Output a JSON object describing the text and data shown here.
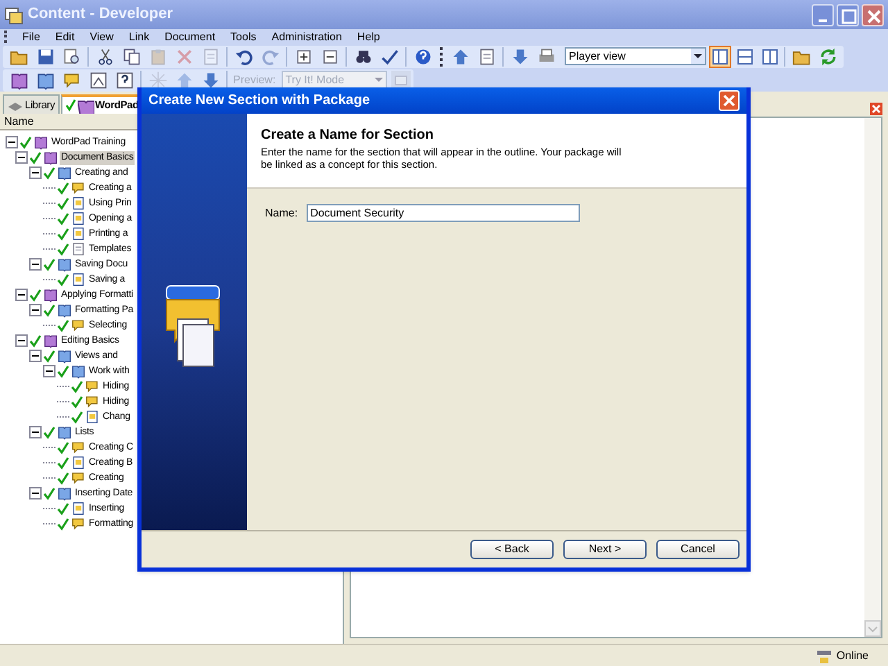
{
  "window": {
    "title": "Content - Developer"
  },
  "menu": [
    "File",
    "Edit",
    "View",
    "Link",
    "Document",
    "Tools",
    "Administration",
    "Help"
  ],
  "toolbar_1": [
    {
      "kind": "folder",
      "disabled": false
    },
    {
      "kind": "save",
      "disabled": false
    },
    {
      "kind": "preview",
      "disabled": false
    },
    {
      "kind": "sep"
    },
    {
      "kind": "cut",
      "disabled": false
    },
    {
      "kind": "copy",
      "disabled": false
    },
    {
      "kind": "paste",
      "disabled": true
    },
    {
      "kind": "delete",
      "disabled": true
    },
    {
      "kind": "page",
      "disabled": true
    },
    {
      "kind": "sep"
    },
    {
      "kind": "undo",
      "disabled": false
    },
    {
      "kind": "redo",
      "disabled": true
    },
    {
      "kind": "sep"
    },
    {
      "kind": "expand",
      "disabled": false
    },
    {
      "kind": "collapse",
      "disabled": false
    },
    {
      "kind": "sep"
    },
    {
      "kind": "find",
      "disabled": false
    },
    {
      "kind": "spell",
      "disabled": false
    },
    {
      "kind": "sep"
    },
    {
      "kind": "help",
      "disabled": false
    },
    {
      "kind": "grip"
    },
    {
      "kind": "up",
      "disabled": false
    },
    {
      "kind": "page",
      "disabled": false
    },
    {
      "kind": "sep"
    },
    {
      "kind": "down",
      "disabled": false
    },
    {
      "kind": "print",
      "disabled": false
    }
  ],
  "view_dropdown": {
    "value": "Player view"
  },
  "view_toggles": [
    {
      "selected": true
    },
    {
      "selected": false
    },
    {
      "selected": false
    }
  ],
  "toolbar_1_end": [
    {
      "kind": "folder",
      "disabled": false
    },
    {
      "kind": "refresh",
      "disabled": false
    }
  ],
  "toolbar_2": [
    {
      "kind": "module",
      "disabled": false
    },
    {
      "kind": "section",
      "disabled": false
    },
    {
      "kind": "topic",
      "disabled": false
    },
    {
      "kind": "frame",
      "disabled": false
    },
    {
      "kind": "question",
      "disabled": false
    },
    {
      "kind": "sep"
    },
    {
      "kind": "star",
      "disabled": true
    },
    {
      "kind": "up",
      "disabled": true
    },
    {
      "kind": "down",
      "disabled": false
    }
  ],
  "preview": {
    "label": "Preview:",
    "value": "Try It! Mode",
    "disabled": true
  },
  "tabs": [
    {
      "label": "Library",
      "selected": false
    },
    {
      "label": "WordPad",
      "selected": true
    }
  ],
  "tree_header": "Name",
  "tree": [
    {
      "label": "WordPad Training",
      "kind": "module",
      "expanded": true,
      "selected": false,
      "children": [
        {
          "label": "Document Basics",
          "kind": "module",
          "expanded": true,
          "selected": true,
          "children": [
            {
              "label": "Creating and",
              "kind": "section",
              "expanded": true,
              "selected": false,
              "children": [
                {
                  "label": "Creating a",
                  "kind": "topic",
                  "selected": false
                },
                {
                  "label": "Using Prin",
                  "kind": "doc",
                  "selected": false
                },
                {
                  "label": "Opening a",
                  "kind": "doc",
                  "selected": false
                },
                {
                  "label": "Printing a",
                  "kind": "doc",
                  "selected": false
                },
                {
                  "label": "Templates",
                  "kind": "page",
                  "selected": false
                }
              ]
            },
            {
              "label": "Saving Docu",
              "kind": "section",
              "expanded": true,
              "selected": false,
              "children": [
                {
                  "label": "Saving a",
                  "kind": "doc",
                  "selected": false
                }
              ]
            }
          ]
        },
        {
          "label": "Applying Formatti",
          "kind": "module",
          "expanded": true,
          "selected": false,
          "children": [
            {
              "label": "Formatting Pa",
              "kind": "section",
              "expanded": true,
              "selected": false,
              "children": [
                {
                  "label": "Selecting",
                  "kind": "topic",
                  "selected": false
                }
              ]
            }
          ]
        },
        {
          "label": "Editing Basics",
          "kind": "module",
          "expanded": true,
          "selected": false,
          "children": [
            {
              "label": "Views and",
              "kind": "section",
              "expanded": true,
              "selected": false,
              "children": [
                {
                  "label": "Work with",
                  "kind": "section",
                  "expanded": true,
                  "selected": false,
                  "children": [
                    {
                      "label": "Hiding",
                      "kind": "topic",
                      "selected": false
                    },
                    {
                      "label": "Hiding",
                      "kind": "topic",
                      "selected": false
                    },
                    {
                      "label": "Chang",
                      "kind": "doc",
                      "selected": false
                    }
                  ]
                }
              ]
            },
            {
              "label": "Lists",
              "kind": "section",
              "expanded": true,
              "selected": false,
              "children": [
                {
                  "label": "Creating C",
                  "kind": "topic",
                  "selected": false
                },
                {
                  "label": "Creating B",
                  "kind": "doc",
                  "selected": false
                },
                {
                  "label": "Creating",
                  "kind": "topic",
                  "selected": false
                }
              ]
            },
            {
              "label": "Inserting Date",
              "kind": "section",
              "expanded": true,
              "selected": false,
              "children": [
                {
                  "label": "Inserting",
                  "kind": "doc",
                  "selected": false
                },
                {
                  "label": "Formatting",
                  "kind": "topic",
                  "selected": false
                }
              ]
            }
          ]
        }
      ]
    }
  ],
  "dialog": {
    "title": "Create New Section with Package",
    "heading": "Create a Name for Section",
    "description": "Enter the name for the section that will appear in the outline. Your package will be linked as a concept for this section.",
    "field_label": "Name:",
    "field_value": "Document Security",
    "buttons": [
      "< Back",
      "Next >",
      "Cancel"
    ]
  },
  "status_bar": {
    "text": "Online"
  }
}
